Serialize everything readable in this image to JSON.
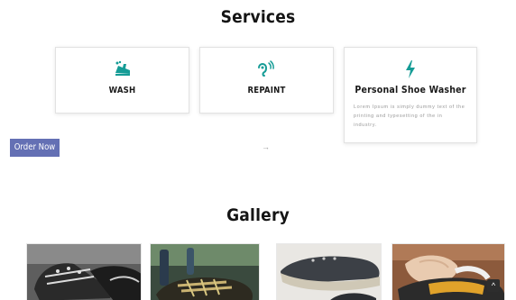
{
  "services": {
    "title": "Services",
    "cards": [
      {
        "label": "WASH",
        "icon": "shoe-wash-icon"
      },
      {
        "label": "REPAINT",
        "icon": "hearing-icon"
      },
      {
        "label": "Personal Shoe Washer",
        "icon": "lightning-bolt-icon",
        "description": "Lorem Ipsum is simply dummy text of the printing and typesetting of the in industry."
      }
    ],
    "accent_color": "#159c96"
  },
  "order": {
    "button_label": "Order Now",
    "button_color": "#6470b4",
    "arrow": "→"
  },
  "gallery": {
    "title": "Gallery",
    "images": [
      {
        "subject": "black-and-white sneakers"
      },
      {
        "subject": "sneaker with cleaning products"
      },
      {
        "subject": "dark canvas sneaker"
      },
      {
        "subject": "hands cleaning sneaker"
      }
    ]
  },
  "scroll_top": {
    "icon": "chevron-up-icon",
    "glyph": "^"
  }
}
